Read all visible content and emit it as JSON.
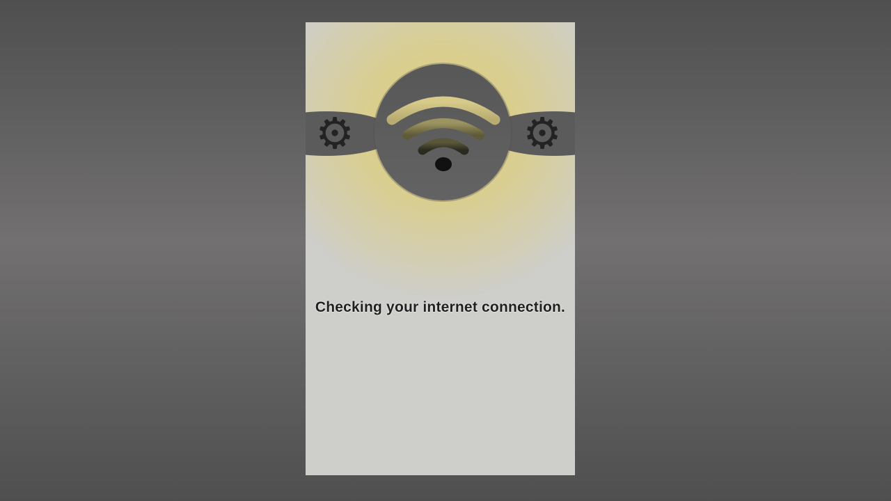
{
  "screen": {
    "status_text": "Checking your internet connection."
  },
  "icons": {
    "left_gear": "⚙",
    "right_gear": "⚙",
    "center": "wifi-icon"
  },
  "colors": {
    "background_outer": "#5a5a5a",
    "panel": "#cececb",
    "glow": "#e2d278",
    "band": "#5b5b5b",
    "gear": "#232323",
    "text": "#202020"
  }
}
